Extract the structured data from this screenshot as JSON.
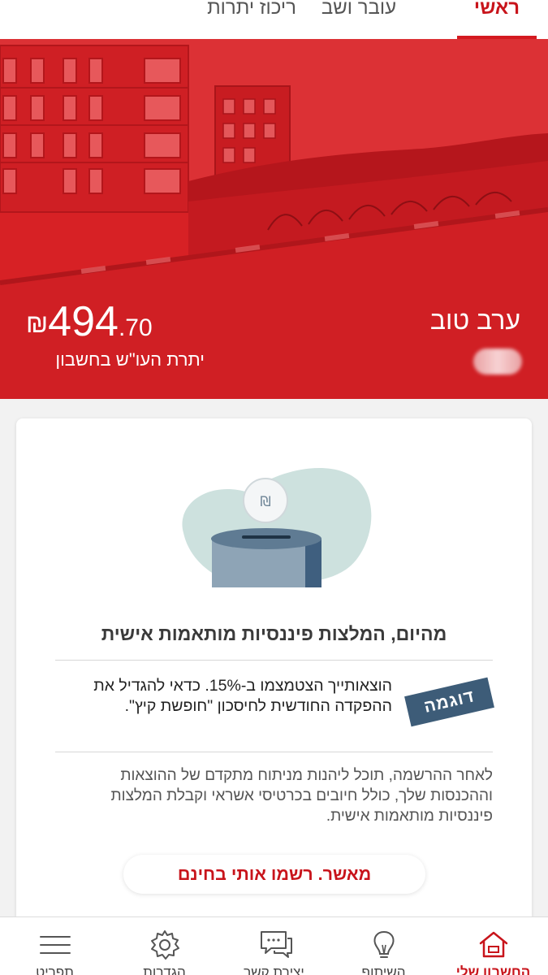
{
  "tabs": [
    {
      "label": "ראשי",
      "active": true
    },
    {
      "label": "עובר ושב",
      "active": false
    },
    {
      "label": "ריכוז יתרות",
      "active": false
    }
  ],
  "hero": {
    "greeting": "ערב טוב",
    "balance_currency": "₪",
    "balance_integer": "494",
    "balance_decimal": ".70",
    "balance_label": "יתרת העו\"ש בחשבון"
  },
  "card": {
    "illustration_coin_symbol": "₪",
    "title": "מהיום, המלצות פיננסיות מותאמות אישית",
    "badge": "דוגמה",
    "example_text": "הוצאותייך הצטמצמו ב-15%. כדאי להגדיל את ההפקדה החודשית לחיסכון \"חופשת קיץ\".",
    "description": "לאחר ההרשמה, תוכל ליהנות מניתוח מתקדם של ההוצאות וההכנסות שלך, כולל חיובים בכרטיסי אשראי וקבלת המלצות פיננסיות מותאמות אישית.",
    "cta": "מאשר. רשמו אותי בחינם"
  },
  "bottom_nav": [
    {
      "label": "החשבון שלי",
      "icon": "home-icon",
      "active": true
    },
    {
      "label": "השיתוף",
      "icon": "lightbulb-icon",
      "active": false
    },
    {
      "label": "יצירת קשר",
      "icon": "chat-icon",
      "active": false
    },
    {
      "label": "הגדרות",
      "icon": "gear-icon",
      "active": false
    },
    {
      "label": "תפריט",
      "icon": "menu-icon",
      "active": false
    }
  ],
  "colors": {
    "brand_red": "#d72125",
    "accent_red": "#c8141b",
    "badge_blue": "#3d5c78"
  }
}
